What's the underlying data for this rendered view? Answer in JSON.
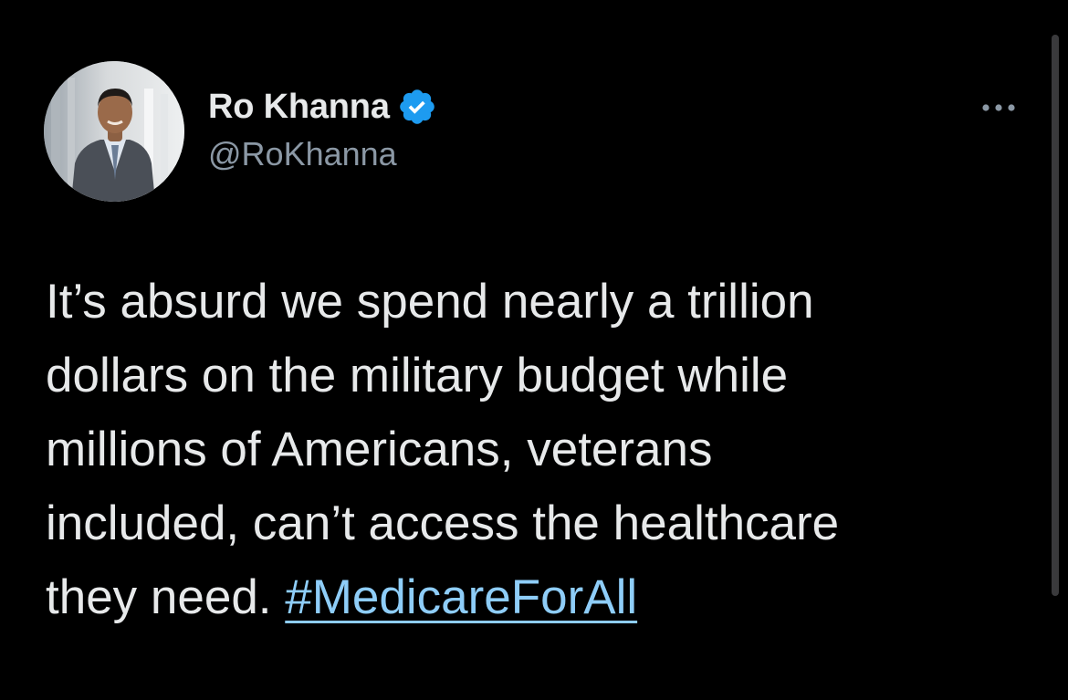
{
  "author": {
    "display_name": "Ro Khanna",
    "handle": "@RoKhanna",
    "verified": true,
    "avatar_icon": "person-photo-avatar"
  },
  "icons": {
    "verified": "verified-badge-icon",
    "more": "more-options-icon"
  },
  "tweet": {
    "lines": [
      "It’s absurd we spend nearly a trillion",
      "dollars on the military budget while",
      "millions of Americans, veterans",
      "included, can’t access the healthcare"
    ],
    "last_line_prefix": "they need. ",
    "hashtag": "#MedicareForAll"
  },
  "colors": {
    "background": "#000000",
    "text": "#e7e9ea",
    "secondary_text": "#8b98a5",
    "link": "#8ecdf8",
    "verified": "#1d9bf0"
  }
}
